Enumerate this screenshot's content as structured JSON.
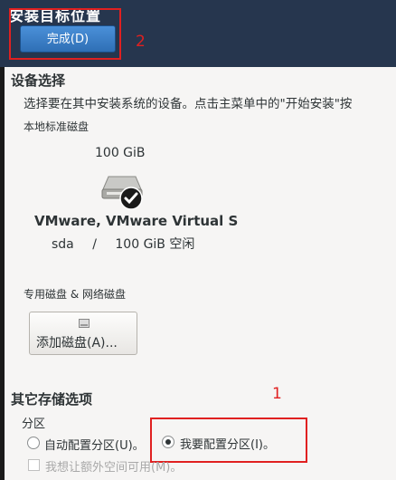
{
  "header": {
    "title": "安装目标位置",
    "done_button": "完成(D)"
  },
  "annotations": {
    "label_1": "1",
    "label_2": "2",
    "color": "#e02020"
  },
  "device_selection": {
    "title": "设备选择",
    "description": "选择要在其中安装系统的设备。点击主菜单中的\"开始安装\"按",
    "local_disks_label": "本地标准磁盘",
    "disk": {
      "size": "100 GiB",
      "name": "VMware, VMware Virtual S",
      "device": "sda",
      "separator": "/",
      "free": "100 GiB 空闲",
      "selected": true
    },
    "special_disks_label": "专用磁盘 & 网络磁盘",
    "add_disk_button": "添加磁盘(A)..."
  },
  "other_storage": {
    "title": "其它存储选项",
    "partition_label": "分区",
    "auto_partition": "自动配置分区(U)。",
    "manual_partition": "我要配置分区(I)。",
    "selected": "manual",
    "extra_space": "我想让额外空间可用(M)。"
  },
  "colors": {
    "header_bg": "#26364e",
    "accent": "#2f6fb5"
  }
}
